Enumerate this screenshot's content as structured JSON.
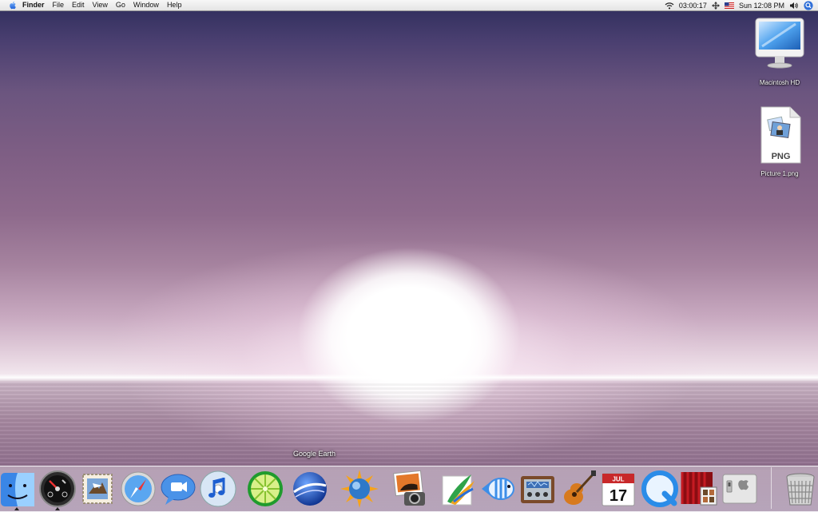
{
  "menubar": {
    "app_name": "Finder",
    "items": [
      "File",
      "Edit",
      "View",
      "Go",
      "Window",
      "Help"
    ],
    "timer": "03:00:17",
    "clock": "Sun 12:08 PM"
  },
  "desktop": {
    "icons": [
      {
        "label": "Macintosh HD",
        "icon": "hard-drive-icon"
      },
      {
        "label": "Picture 1.png",
        "icon": "png-file-icon",
        "badge": "PNG"
      }
    ]
  },
  "dock": {
    "tooltip": "Google Earth",
    "calendar": {
      "month": "JUL",
      "day": "17"
    },
    "apps": [
      {
        "icon": "finder-icon",
        "running": true
      },
      {
        "icon": "dashboard-icon",
        "running": true
      },
      {
        "icon": "mail-icon",
        "running": false
      },
      {
        "icon": "safari-icon",
        "running": false
      },
      {
        "icon": "ichat-icon",
        "running": false
      },
      {
        "icon": "itunes-icon",
        "running": false
      },
      {
        "icon": "limewire-icon",
        "running": false
      },
      {
        "icon": "google-earth-icon",
        "running": false
      },
      {
        "icon": "weather-sun-icon",
        "running": false
      },
      {
        "icon": "iphoto-icon",
        "running": false
      },
      {
        "icon": "painting-app-icon",
        "running": false
      },
      {
        "icon": "fish-app-icon",
        "running": false
      },
      {
        "icon": "audio-mixer-icon",
        "running": false
      },
      {
        "icon": "garageband-icon",
        "running": false
      },
      {
        "icon": "ical-icon",
        "running": false
      },
      {
        "icon": "quicktime-icon",
        "running": false
      },
      {
        "icon": "front-row-icon",
        "running": false
      },
      {
        "icon": "boot-camp-icon",
        "running": false
      },
      {
        "icon": "trash-icon",
        "running": false
      }
    ]
  },
  "colors": {
    "sky_top": "#2c2c5a",
    "sky_mid": "#8e6a8c",
    "horizon": "#f3e8ef",
    "sea": "#7e5c7f"
  }
}
